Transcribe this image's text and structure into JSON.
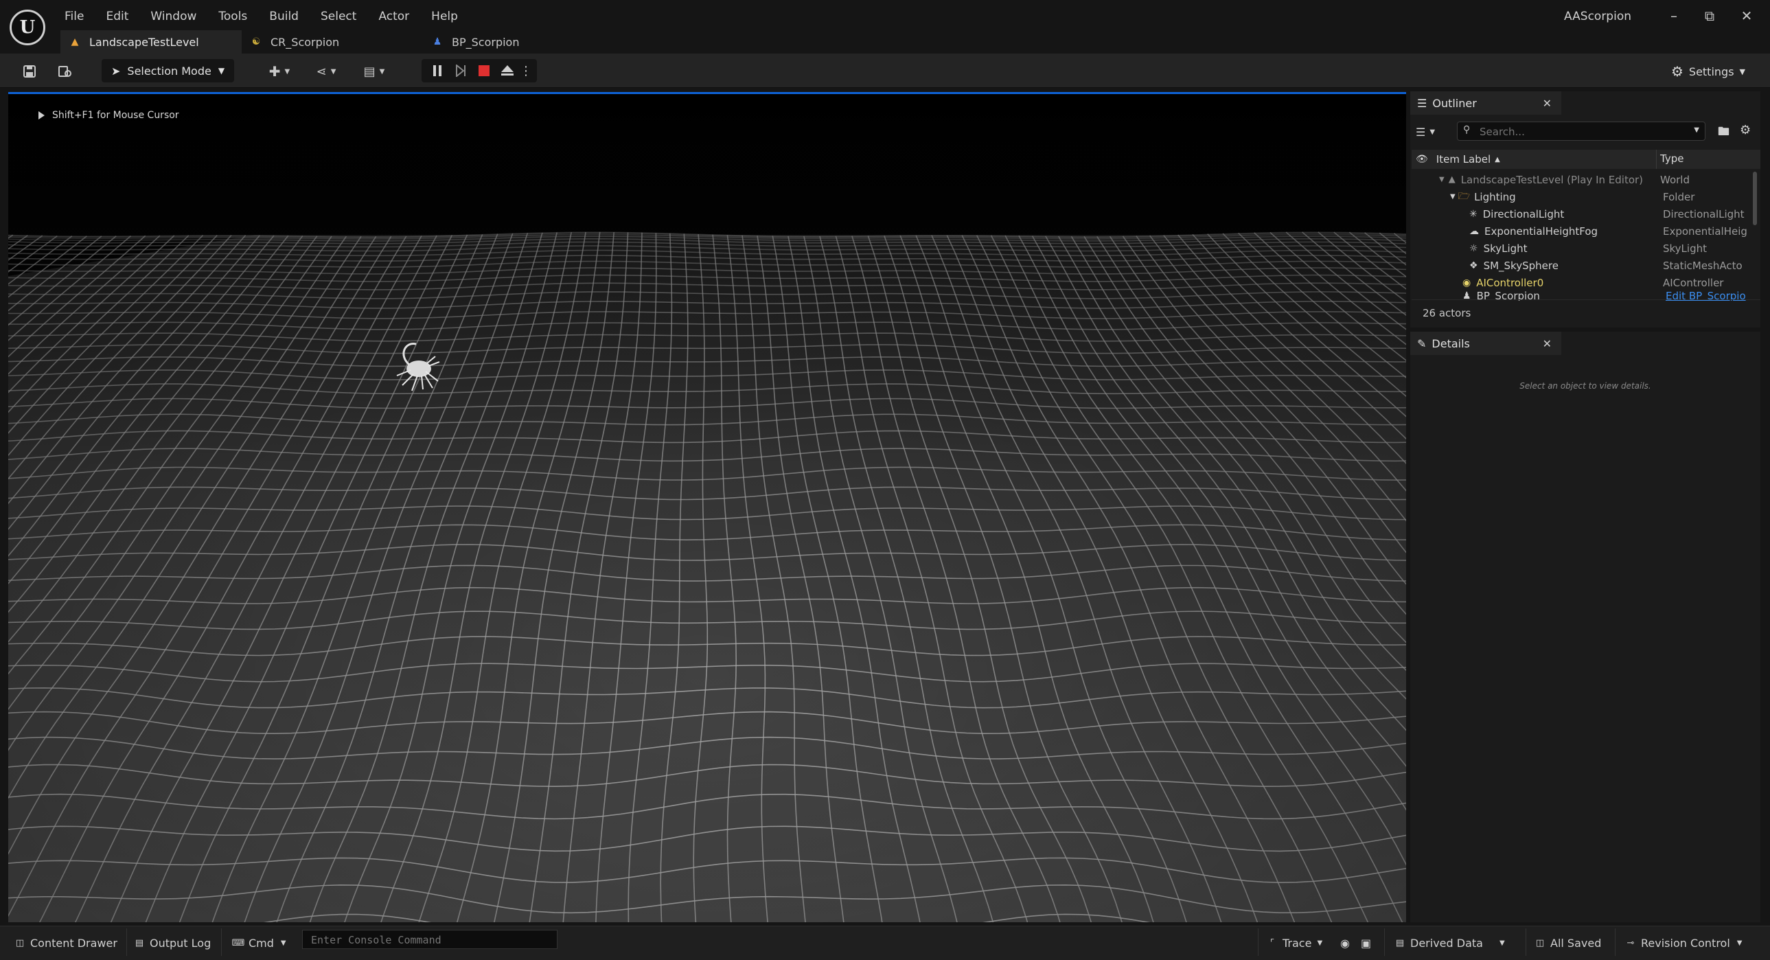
{
  "menu": [
    "File",
    "Edit",
    "Window",
    "Tools",
    "Build",
    "Select",
    "Actor",
    "Help"
  ],
  "app_title": "AAScorpion",
  "tabs": [
    {
      "label": "LandscapeTestLevel",
      "icon": "level-icon",
      "active": true
    },
    {
      "label": "CR_Scorpion",
      "icon": "control-rig-icon",
      "active": false
    },
    {
      "label": "BP_Scorpion",
      "icon": "blueprint-pawn-icon",
      "active": false
    }
  ],
  "toolbar": {
    "selection_mode": "Selection Mode",
    "settings": "Settings"
  },
  "viewport": {
    "hint": "Shift+F1 for Mouse Cursor"
  },
  "outliner": {
    "title": "Outliner",
    "search_placeholder": "Search...",
    "col_label": "Item Label",
    "col_type": "Type",
    "rows": [
      {
        "label": "LandscapeTestLevel (Play In Editor)",
        "type": "World"
      },
      {
        "label": "Lighting",
        "type": "Folder"
      },
      {
        "label": "DirectionalLight",
        "type": "DirectionalLight"
      },
      {
        "label": "ExponentialHeightFog",
        "type": "ExponentialHeig"
      },
      {
        "label": "SkyLight",
        "type": "SkyLight"
      },
      {
        "label": "SM_SkySphere",
        "type": "StaticMeshActo"
      },
      {
        "label": "AIController0",
        "type": "AIController"
      },
      {
        "label": "BP_Scorpion",
        "type": "Edit BP_Scorpio"
      }
    ],
    "actor_count": "26 actors"
  },
  "details": {
    "title": "Details",
    "empty_text": "Select an object to view details."
  },
  "statusbar": {
    "content_drawer": "Content Drawer",
    "output_log": "Output Log",
    "cmd": "Cmd",
    "console_placeholder": "Enter Console Command",
    "trace": "Trace",
    "derived_data": "Derived Data",
    "all_saved": "All Saved",
    "revision_control": "Revision Control"
  }
}
